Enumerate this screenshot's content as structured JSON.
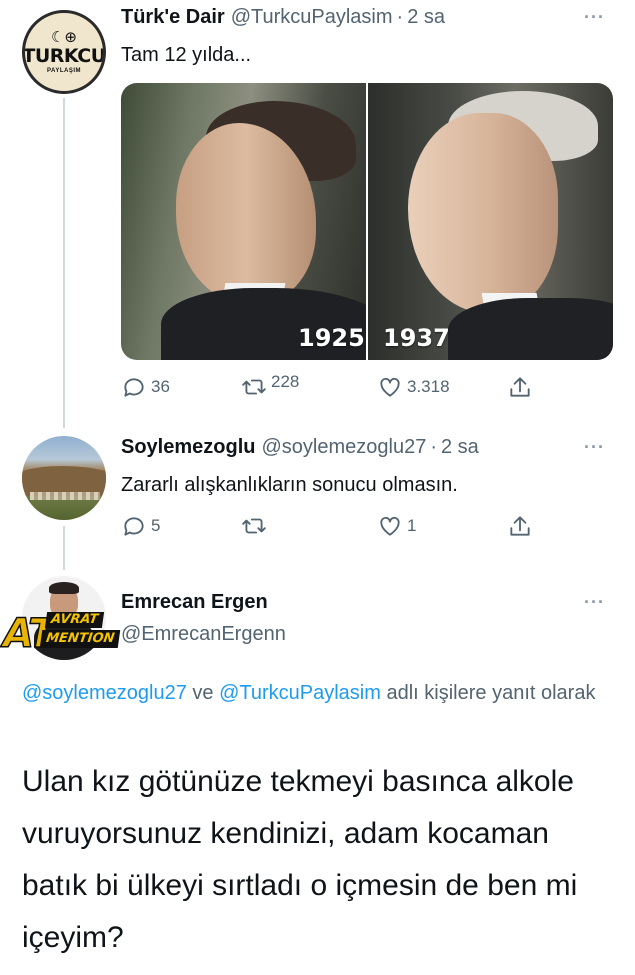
{
  "tweet1": {
    "avatar": {
      "top": "☾⊕",
      "main": "TURKCU",
      "sub": "PAYLAŞIM"
    },
    "name": "Türk'e Dair",
    "handle": "@TurkcuPaylasim",
    "separator": "·",
    "time": "2 sa",
    "more": "···",
    "text": "Tam 12 yılda...",
    "media": {
      "year_left": "1925",
      "year_right": "1937"
    },
    "actions": {
      "reply": "36",
      "retweet": "228",
      "like": "3.318"
    }
  },
  "tweet2": {
    "name": "Soylemezoglu",
    "handle": "@soylemezoglu27",
    "separator": "·",
    "time": "2 sa",
    "more": "···",
    "text": "Zararlı alışkanlıkların sonucu olmasın.",
    "actions": {
      "reply": "5",
      "retweet": "",
      "like": "1"
    }
  },
  "tweet3": {
    "name": "Emrecan Ergen",
    "handle": "@EmrecanErgenn",
    "more": "···",
    "badge": {
      "at": "AT",
      "avrat": "AVRAT",
      "mention": "MENTION"
    },
    "reply_to": {
      "mention1": "@soylemezoglu27",
      "and": " ve ",
      "mention2": "@TurkcuPaylasim",
      "suffix": " adlı kişilere yanıt olarak"
    },
    "text": "Ulan kız götünüze tekmeyi basınca alkole vuruyorsunuz kendinizi, adam kocaman batık bi ülkeyi sırtladı o içmesin de ben mi içeyim?"
  },
  "colors": {
    "link": "#1d9bf0",
    "secondary_text": "#536471",
    "thread_line": "#cfd9de"
  }
}
